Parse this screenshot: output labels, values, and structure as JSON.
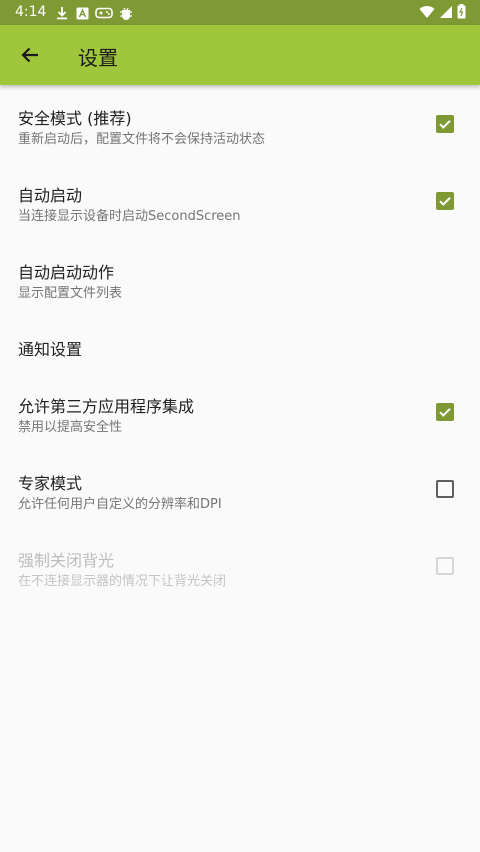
{
  "status_bar": {
    "time": "4:14",
    "notification_icons": [
      "download-icon",
      "a-box-icon",
      "game-controller-icon",
      "bug-icon"
    ],
    "system_icons": [
      "wifi-icon",
      "signal-icon",
      "battery-icon"
    ]
  },
  "app_bar": {
    "back_icon": "arrow-back-icon",
    "title": "设置"
  },
  "settings": [
    {
      "title": "安全模式 (推荐)",
      "subtitle": "重新启动后，配置文件将不会保持活动状态",
      "checkbox": "checked",
      "enabled": true
    },
    {
      "title": "自动启动",
      "subtitle": "当连接显示设备时启动SecondScreen",
      "checkbox": "checked",
      "enabled": true
    },
    {
      "title": "自动启动动作",
      "subtitle": "显示配置文件列表",
      "checkbox": "none",
      "enabled": true
    },
    {
      "title": "通知设置",
      "subtitle": "",
      "checkbox": "none",
      "enabled": true
    },
    {
      "title": "允许第三方应用程序集成",
      "subtitle": "禁用以提高安全性",
      "checkbox": "checked",
      "enabled": true
    },
    {
      "title": "专家模式",
      "subtitle": "允许任何用户自定义的分辨率和DPI",
      "checkbox": "unchecked",
      "enabled": true
    },
    {
      "title": "强制关闭背光",
      "subtitle": "在不连接显示器的情况下让背光关闭",
      "checkbox": "unchecked",
      "enabled": false
    }
  ],
  "colors": {
    "status_bar": "#7f9a35",
    "app_bar": "#a0c63c",
    "accent": "#7f9a35",
    "background": "#fafafa"
  }
}
